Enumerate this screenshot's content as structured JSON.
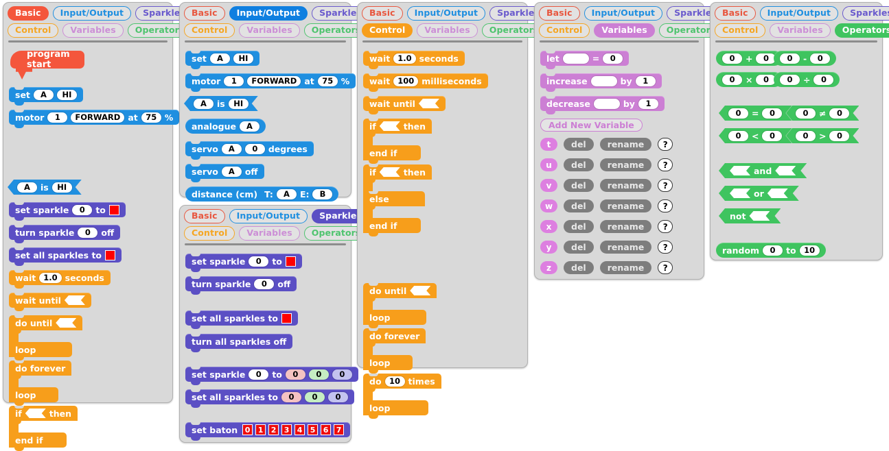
{
  "tabs": {
    "basic": "Basic",
    "io": "Input/Output",
    "sparkles": "Sparkles",
    "control": "Control",
    "variables": "Variables",
    "operators": "Operators"
  },
  "colors": {
    "basic": "#f4563c",
    "io": "#1f8fe0",
    "sparkles": "#5b4fc4",
    "control": "#f79e1b",
    "variables": "#cc7fd4",
    "operators": "#3fc45f",
    "panel_bg": "#d9d9d9",
    "swatch_red": "#ff0000"
  },
  "panels": [
    {
      "id": "basic",
      "active_tab": "Basic"
    },
    {
      "id": "io",
      "active_tab": "Input/Output"
    },
    {
      "id": "sparkles",
      "active_tab": "Sparkles"
    },
    {
      "id": "control",
      "active_tab": "Control"
    },
    {
      "id": "variables",
      "active_tab": "Variables"
    },
    {
      "id": "operators",
      "active_tab": "Operators"
    }
  ],
  "basic": {
    "program_start": "program start",
    "set": "set",
    "set_pin": "A",
    "set_val": "HI",
    "motor": "motor",
    "motor_num": "1",
    "motor_dir": "FORWARD",
    "motor_at": "at",
    "motor_pct": "75",
    "motor_unit": "%",
    "is_pin": "A",
    "is_word": "is",
    "is_val": "HI",
    "set_sparkle": "set sparkle",
    "set_sparkle_idx": "0",
    "set_sparkle_to": "to",
    "turn_sparkle": "turn sparkle",
    "turn_sparkle_idx": "0",
    "turn_sparkle_off": "off",
    "set_all_sparkles": "set all sparkles to",
    "wait": "wait",
    "wait_val": "1.0",
    "wait_unit": "seconds",
    "wait_until": "wait until",
    "do_until": "do until",
    "loop": "loop",
    "do_forever": "do forever",
    "if": "if",
    "then": "then",
    "end_if": "end if"
  },
  "io": {
    "set": "set",
    "set_pin": "A",
    "set_val": "HI",
    "motor": "motor",
    "motor_num": "1",
    "motor_dir": "FORWARD",
    "motor_at": "at",
    "motor_pct": "75",
    "motor_unit": "%",
    "is_pin": "A",
    "is_word": "is",
    "is_val": "HI",
    "analogue": "analogue",
    "analogue_pin": "A",
    "servo": "servo",
    "servo_pin": "A",
    "servo_deg": "0",
    "servo_unit": "degrees",
    "servo_off_lbl": "servo",
    "servo_off_pin": "A",
    "servo_off": "off",
    "distance": "distance (cm)",
    "distance_t": "T:",
    "distance_t_pin": "A",
    "distance_e": "E:",
    "distance_e_pin": "B"
  },
  "sparkles": {
    "set_sparkle": "set sparkle",
    "set_sparkle_idx": "0",
    "to": "to",
    "turn_sparkle": "turn sparkle",
    "turn_sparkle_idx": "0",
    "off": "off",
    "set_all_to": "set all sparkles to",
    "turn_all_off": "turn all sparkles off",
    "set_sparkle_rgb": "set sparkle",
    "rgb_idx": "0",
    "rgb_to": "to",
    "rgb_r": "0",
    "rgb_g": "0",
    "rgb_b": "0",
    "set_all_rgb": "set all sparkles to",
    "all_rgb_r": "0",
    "all_rgb_g": "0",
    "all_rgb_b": "0",
    "set_baton": "set baton",
    "baton": [
      "0",
      "1",
      "2",
      "3",
      "4",
      "5",
      "6",
      "7"
    ]
  },
  "control": {
    "wait": "wait",
    "wait_sec_val": "1.0",
    "wait_sec_unit": "seconds",
    "wait_ms": "wait",
    "wait_ms_val": "100",
    "wait_ms_unit": "milliseconds",
    "wait_until": "wait until",
    "if": "if",
    "then": "then",
    "end_if": "end if",
    "else": "else",
    "do_until": "do until",
    "loop": "loop",
    "do_forever": "do forever",
    "do": "do",
    "do_times_val": "10",
    "times": "times"
  },
  "variables": {
    "let": "let",
    "let_eq": "=",
    "let_val": "0",
    "increase": "increase",
    "increase_by": "by",
    "increase_val": "1",
    "decrease": "decrease",
    "decrease_by": "by",
    "decrease_val": "1",
    "add_new": "Add New Variable",
    "del": "del",
    "rename": "rename",
    "help": "?",
    "names": [
      "t",
      "u",
      "v",
      "w",
      "x",
      "y",
      "z"
    ]
  },
  "operators": {
    "zero": "0",
    "plus": "+",
    "minus": "-",
    "times": "×",
    "divide": "÷",
    "eq": "=",
    "neq": "≠",
    "lt": "<",
    "gt": ">",
    "and": "and",
    "or": "or",
    "not": "not",
    "random": "random",
    "random_from": "0",
    "random_to_lbl": "to",
    "random_to": "10"
  }
}
